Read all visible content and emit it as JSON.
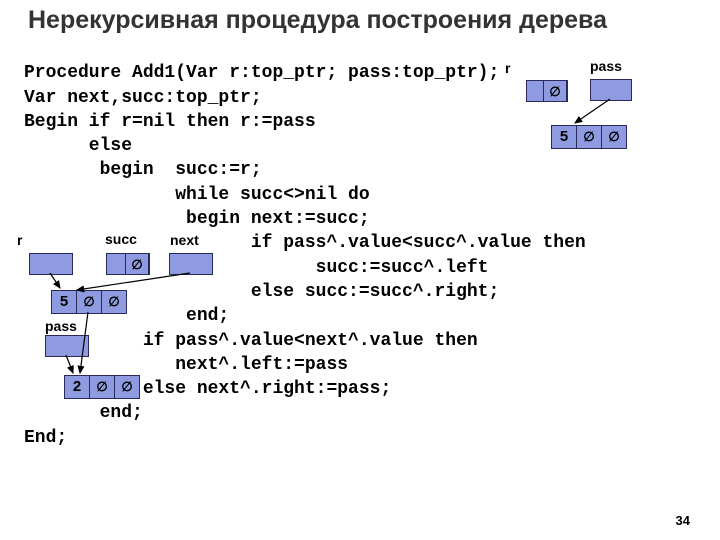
{
  "title": "Нерекурсивная процедура построения дерева",
  "code": {
    "l1": "Procedure Add1(Var r:top_ptr; pass:top_ptr);",
    "l2": "Var next,succ:top_ptr;",
    "l3": "Begin if r=nil then r:=pass",
    "l4": "      else",
    "l5": "       begin  succ:=r;",
    "l6": "              while succ<>nil do",
    "l7": "               begin next:=succ;",
    "l8": "                     if pass^.value<succ^.value then",
    "l9": "                           succ:=succ^.left",
    "l10": "                     else succ:=succ^.right;",
    "l11": "               end;",
    "l12": "           if pass^.value<next^.value then",
    "l13": "              next^.left:=pass",
    "l14": "           else next^.right:=pass;",
    "l15": "       end;",
    "l16": "End;"
  },
  "labels": {
    "r1": "r",
    "pass1": "pass",
    "succ": "succ",
    "next": "next",
    "r2": "r",
    "pass2": "pass"
  },
  "nil": "∅",
  "vals": {
    "five": "5",
    "two": "2"
  },
  "slide": "34"
}
